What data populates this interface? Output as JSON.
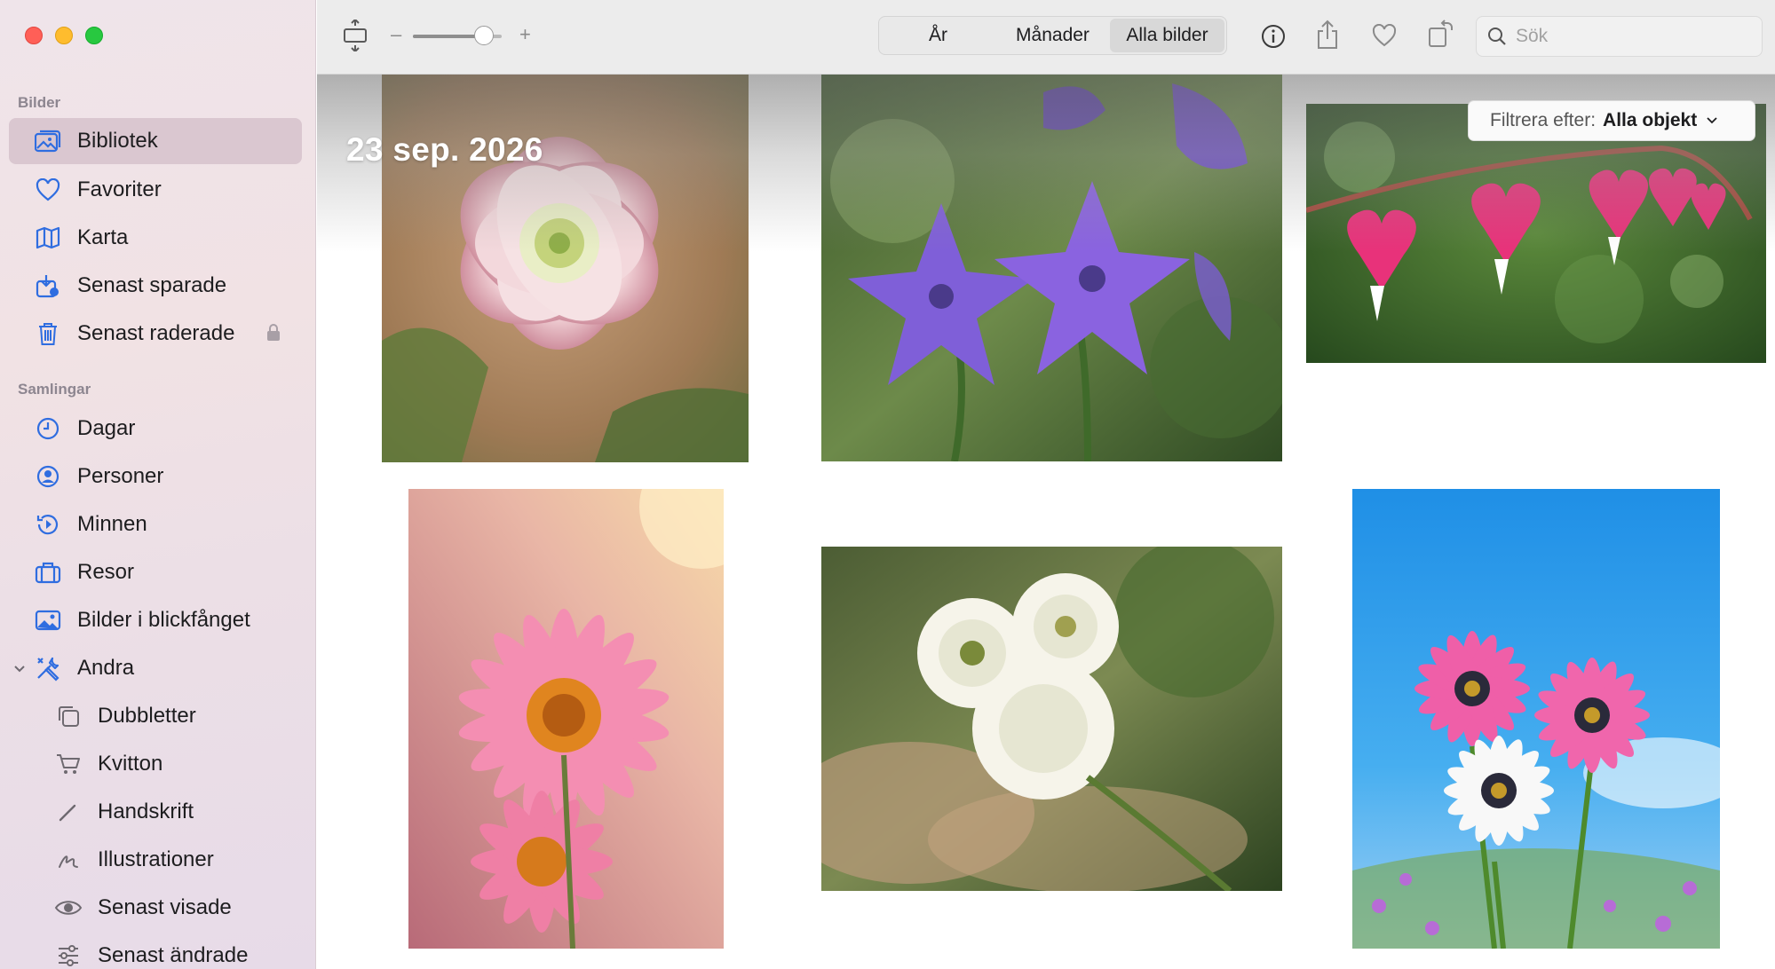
{
  "sidebar": {
    "sections": {
      "library": "Bilder",
      "collections": "Samlingar"
    },
    "library_items": [
      {
        "label": "Bibliotek",
        "icon": "photo-library-icon",
        "selected": true
      },
      {
        "label": "Favoriter",
        "icon": "heart-icon"
      },
      {
        "label": "Karta",
        "icon": "map-icon"
      },
      {
        "label": "Senast sparade",
        "icon": "recently-saved-icon"
      },
      {
        "label": "Senast raderade",
        "icon": "trash-icon",
        "locked": true
      }
    ],
    "collection_items": [
      {
        "label": "Dagar",
        "icon": "clock-icon"
      },
      {
        "label": "Personer",
        "icon": "person-icon"
      },
      {
        "label": "Minnen",
        "icon": "memories-icon"
      },
      {
        "label": "Resor",
        "icon": "suitcase-icon"
      },
      {
        "label": "Bilder i blickfånget",
        "icon": "featured-photos-icon"
      },
      {
        "label": "Andra",
        "icon": "tools-icon",
        "expanded": true
      }
    ],
    "other_items": [
      {
        "label": "Dubbletter",
        "icon": "duplicates-icon"
      },
      {
        "label": "Kvitton",
        "icon": "cart-icon"
      },
      {
        "label": "Handskrift",
        "icon": "pencil-icon"
      },
      {
        "label": "Illustrationer",
        "icon": "scribble-icon"
      },
      {
        "label": "Senast visade",
        "icon": "eye-icon"
      },
      {
        "label": "Senast ändrade",
        "icon": "sliders-icon"
      }
    ]
  },
  "toolbar": {
    "zoom_minus": "–",
    "zoom_plus": "+",
    "zoom_level": 0.8,
    "views": [
      "År",
      "Månader",
      "Alla bilder"
    ],
    "active_view": "Alla bilder",
    "search_placeholder": "Sök"
  },
  "content": {
    "date_label": "23 sep. 2026",
    "filter": {
      "prefix": "Filtrera efter:",
      "value": "Alla objekt"
    }
  },
  "colors": {
    "accent": "#2f6de0",
    "selected_row": "#d9c6d0",
    "close": "#ff5f57",
    "minimize": "#febc2e",
    "zoom": "#28c840"
  }
}
